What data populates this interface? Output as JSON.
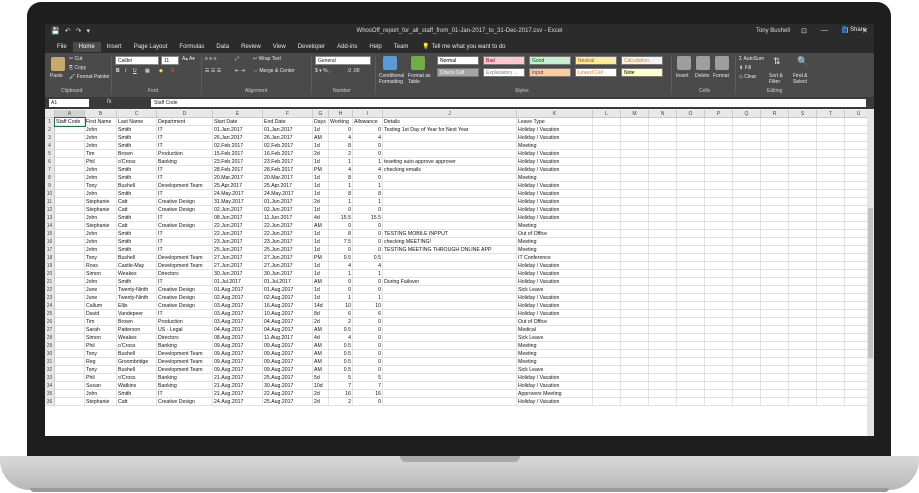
{
  "title_bar": {
    "title": "WhosOff_report_for_all_staff_from_01-Jan-2017_to_31-Dec-2017.csv - Excel",
    "user": "Tony Bushell",
    "qat": [
      "💾",
      "↶",
      "↷",
      "▾"
    ],
    "win_buttons": [
      "⊡",
      "—",
      "❐",
      "✕"
    ]
  },
  "tabs": [
    "File",
    "Home",
    "Insert",
    "Page Layout",
    "Formulas",
    "Data",
    "Review",
    "View",
    "Developer",
    "Add-ins",
    "Help",
    "Team"
  ],
  "active_tab": "Home",
  "tell_me": "Tell me what you want to do",
  "share": "Share",
  "ribbon": {
    "clipboard": {
      "paste": "Paste",
      "cut": "Cut",
      "copy": "Copy",
      "format_painter": "Format Painter",
      "label": "Clipboard"
    },
    "font": {
      "name": "Calibri",
      "size": "11",
      "label": "Font"
    },
    "alignment": {
      "wrap_text": "Wrap Text",
      "merge": "Merge & Center",
      "label": "Alignment"
    },
    "number": {
      "format": "General",
      "label": "Number"
    },
    "styles": {
      "conditional": "Conditional Formatting",
      "format_table": "Format as Table",
      "cells": [
        {
          "text": "Normal",
          "bg": "#ffffff",
          "fg": "#000000"
        },
        {
          "text": "Bad",
          "bg": "#ffc7ce",
          "fg": "#9c0006"
        },
        {
          "text": "Good",
          "bg": "#c6efce",
          "fg": "#006100"
        },
        {
          "text": "Neutral",
          "bg": "#ffeb9c",
          "fg": "#9c5700"
        },
        {
          "text": "Calculation",
          "bg": "#f2f2f2",
          "fg": "#fa7d00"
        },
        {
          "text": "Check Cell",
          "bg": "#a5a5a5",
          "fg": "#ffffff"
        },
        {
          "text": "Explanatory ...",
          "bg": "#ffffff",
          "fg": "#7f7f7f"
        },
        {
          "text": "Input",
          "bg": "#ffcc99",
          "fg": "#3f3f76"
        },
        {
          "text": "Linked Cell",
          "bg": "#ffffff",
          "fg": "#fa7d00"
        },
        {
          "text": "Note",
          "bg": "#ffffcc",
          "fg": "#000000"
        }
      ],
      "label": "Styles"
    },
    "cells_group": {
      "insert": "Insert",
      "delete": "Delete",
      "format": "Format",
      "label": "Cells"
    },
    "editing": {
      "autosum": "AutoSum",
      "fill": "Fill",
      "clear": "Clear",
      "sort": "Sort & Filter",
      "find": "Find & Select",
      "label": "Editing"
    }
  },
  "formula_bar": {
    "name_box": "A1",
    "fx": "fx",
    "content": "Staff Code"
  },
  "columns": [
    "A",
    "B",
    "C",
    "D",
    "E",
    "F",
    "G",
    "H",
    "I",
    "J",
    "K",
    "L",
    "M",
    "N",
    "O",
    "P",
    "Q",
    "R",
    "S",
    "T",
    "U"
  ],
  "rows": [
    [
      "Staff Code",
      "First Name",
      "Last Name",
      "Department",
      "Start Date",
      "End Date",
      "Days",
      "Working",
      "Allowance",
      "Details",
      "Leave Type"
    ],
    [
      "",
      "John",
      "Smith",
      "IT",
      "01.Jan.2017",
      "01.Jan.2017",
      "1d",
      "0",
      "0",
      "Testing 1st Day of Year for Next Year",
      "Holiday / Vacation"
    ],
    [
      "",
      "John",
      "Smith",
      "IT",
      "26.Jan.2017",
      "26.Jan.2017",
      "AM",
      "4",
      "4",
      "",
      "Holiday / Vacation"
    ],
    [
      "",
      "John",
      "Smith",
      "IT",
      "02.Feb.2017",
      "02.Feb.2017",
      "1d",
      "8",
      "0",
      "",
      "Meeting"
    ],
    [
      "",
      "Tim",
      "Brown",
      "Production",
      "15.Feb.2017",
      "16.Feb.2017",
      "2d",
      "2",
      "0",
      "",
      "Holiday / Vacation"
    ],
    [
      "",
      "Phil",
      "o'Cross",
      "Banking",
      "23.Feb.2017",
      "23.Feb.2017",
      "1d",
      "1",
      "1",
      "teseting auto approve approver",
      "Holiday / Vacation"
    ],
    [
      "",
      "John",
      "Smith",
      "IT",
      "28.Feb.2017",
      "28.Feb.2017",
      "PM",
      "4",
      "4",
      "checking emails",
      "Holiday / Vacation"
    ],
    [
      "",
      "John",
      "Smith",
      "IT",
      "20.Mar.2017",
      "20.Mar.2017",
      "1d",
      "8",
      "0",
      "",
      "Meeting"
    ],
    [
      "",
      "Tony",
      "Bushell",
      "Development Team",
      "25.Apr.2017",
      "25.Apr.2017",
      "1d",
      "1",
      "1",
      "",
      "Holiday / Vacation"
    ],
    [
      "",
      "John",
      "Smith",
      "IT",
      "24.May.2017",
      "24.May.2017",
      "1d",
      "8",
      "8",
      "",
      "Holiday / Vacation"
    ],
    [
      "",
      "Stephanie",
      "Catt",
      "Creative Design",
      "31.May.2017",
      "01.Jun.2017",
      "2d",
      "1",
      "1",
      "",
      "Holiday / Vacation"
    ],
    [
      "",
      "Stephanie",
      "Catt",
      "Creative Design",
      "02.Jun.2017",
      "02.Jun.2017",
      "1d",
      "0",
      "0",
      "",
      "Holiday / Vacation"
    ],
    [
      "",
      "John",
      "Smith",
      "IT",
      "08.Jun.2017",
      "11.Jun.2017",
      "4d",
      "15.5",
      "15.5",
      "",
      "Holiday / Vacation"
    ],
    [
      "",
      "Stephanie",
      "Catt",
      "Creative Design",
      "22.Jun.2017",
      "22.Jun.2017",
      "AM",
      "0",
      "0",
      "",
      "Meeting"
    ],
    [
      "",
      "John",
      "Smith",
      "IT",
      "22.Jun.2017",
      "22.Jun.2017",
      "1d",
      "8",
      "0",
      "TESTING MOBILE INPPUT",
      "Out of Office"
    ],
    [
      "",
      "John",
      "Smith",
      "IT",
      "23.Jun.2017",
      "23.Jun.2017",
      "1d",
      "7.5",
      "0",
      "checking MEETING!",
      "Meeting"
    ],
    [
      "",
      "John",
      "Smith",
      "IT",
      "25.Jun.2017",
      "25.Jun.2017",
      "1d",
      "0",
      "0",
      "TESTING MEETING THROUGH ONLINE APP",
      "Meeting"
    ],
    [
      "",
      "Tony",
      "Bushell",
      "Development Team",
      "27.Jun.2017",
      "27.Jun.2017",
      "PM",
      "0.5",
      "0.5",
      "",
      "IT Conference"
    ],
    [
      "",
      "Ross",
      "Castle-May",
      "Development Team",
      "27.Jun.2017",
      "27.Jun.2017",
      "1d",
      "4",
      "4",
      "",
      "Holiday / Vacation"
    ],
    [
      "",
      "Simon",
      "Weakes",
      "Directors",
      "30.Jun.2017",
      "30.Jun.2017",
      "1d",
      "1",
      "1",
      "",
      "Holiday / Vacation"
    ],
    [
      "",
      "John",
      "Smith",
      "IT",
      "01.Jul.2017",
      "01.Jul.2017",
      "AM",
      "0",
      "0",
      "During Failover",
      "Holiday / Vacation"
    ],
    [
      "",
      "June",
      "Twenty-Ninth",
      "Creative Design",
      "01.Aug.2017",
      "01.Aug.2017",
      "1d",
      "0",
      "0",
      "",
      "Sick Leave"
    ],
    [
      "",
      "June",
      "Twenty-Ninth",
      "Creative Design",
      "02.Aug.2017",
      "02.Aug.2017",
      "1d",
      "1",
      "1",
      "",
      "Holiday / Vacation"
    ],
    [
      "",
      "Callum",
      "Ellis",
      "Creative Design",
      "03.Aug.2017",
      "16.Aug.2017",
      "14d",
      "10",
      "10",
      "",
      "Holiday / Vacation"
    ],
    [
      "",
      "David",
      "Vandepeer",
      "IT",
      "03.Aug.2017",
      "10.Aug.2017",
      "8d",
      "6",
      "6",
      "",
      "Holiday / Vacation"
    ],
    [
      "",
      "Tim",
      "Brown",
      "Production",
      "03.Aug.2017",
      "04.Aug.2017",
      "2d",
      "2",
      "0",
      "",
      "Out of Office"
    ],
    [
      "",
      "Sarah",
      "Patterson",
      "US - Legal",
      "04.Aug.2017",
      "04.Aug.2017",
      "AM",
      "0.5",
      "0",
      "",
      "Medical"
    ],
    [
      "",
      "Simon",
      "Weakes",
      "Directors",
      "08.Aug.2017",
      "11.Aug.2017",
      "4d",
      "4",
      "0",
      "",
      "Sick Leave"
    ],
    [
      "",
      "Phil",
      "o'Cross",
      "Banking",
      "09.Aug.2017",
      "09.Aug.2017",
      "AM",
      "0.5",
      "0",
      "",
      "Meeting"
    ],
    [
      "",
      "Tony",
      "Bushell",
      "Development Team",
      "09.Aug.2017",
      "09.Aug.2017",
      "AM",
      "0.5",
      "0",
      "",
      "Meeting"
    ],
    [
      "",
      "Reg",
      "Groombridge",
      "Development Team",
      "09.Aug.2017",
      "09.Aug.2017",
      "AM",
      "0.5",
      "0",
      "",
      "Meeting"
    ],
    [
      "",
      "Tony",
      "Bushell",
      "Development Team",
      "09.Aug.2017",
      "09.Aug.2017",
      "AM",
      "0.5",
      "0",
      "",
      "Sick Leave"
    ],
    [
      "",
      "Phil",
      "o'Cross",
      "Banking",
      "21.Aug.2017",
      "25.Aug.2017",
      "5d",
      "5",
      "5",
      "",
      "Holiday / Vacation"
    ],
    [
      "",
      "Susan",
      "Watkins",
      "Banking",
      "21.Aug.2017",
      "30.Aug.2017",
      "10d",
      "7",
      "7",
      "",
      "Holiday / Vacation"
    ],
    [
      "",
      "John",
      "Smith",
      "IT",
      "21.Aug.2017",
      "22.Aug.2017",
      "2d",
      "16",
      "16",
      "",
      "Approvers Meeting"
    ],
    [
      "",
      "Stephanie",
      "Catt",
      "Creative Design",
      "24.Aug.2017",
      "25.Aug.2017",
      "2d",
      "2",
      "0",
      "",
      "Holiday / Vacation"
    ]
  ]
}
